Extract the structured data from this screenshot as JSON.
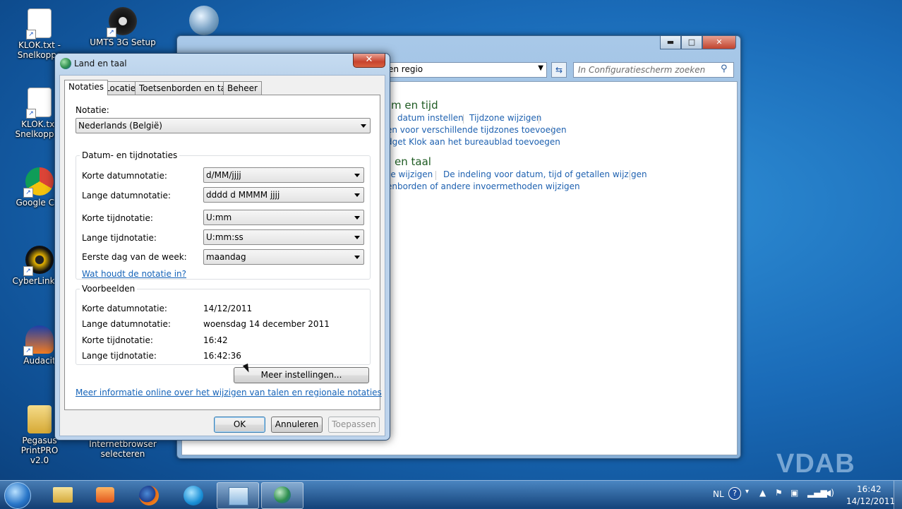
{
  "desktop": {
    "icons": [
      {
        "label": "KLOK.txt - Snelkoppeling",
        "line1": "KLOK.txt -",
        "line2": "Snelkoppe"
      },
      {
        "label": "UMTS 3G Setup",
        "line1": "UMTS 3G Setup",
        "line2": ""
      },
      {
        "label": "KLOK.txt - Snelkoppeling",
        "line1": "KLOK.txt",
        "line2": "Snelkoppeli"
      },
      {
        "label": "Google Chrome",
        "line1": "Google Chr",
        "line2": ""
      },
      {
        "label": "CyberLink",
        "line1": "CyberLink Yo",
        "line2": ""
      },
      {
        "label": "Audacity",
        "line1": "Audacit",
        "line2": ""
      },
      {
        "label": "Pegasus PrintPRO v2.0",
        "line1": "Pegasus PrintPRO",
        "line2": "v2.0"
      },
      {
        "label": "Internetbrowser selecteren",
        "line1": "Internetbrowser",
        "line2": "selecteren"
      }
    ]
  },
  "bg_window": {
    "address_text": "en regio",
    "search_placeholder": "In Configuratiescherm zoeken",
    "section1_title": "m en tijd",
    "section1_links": [
      "datum instellen",
      "Tijdzone wijzigen",
      "en voor verschillende tijdzones toevoegen",
      "dget Klok aan het bureaublad toevoegen"
    ],
    "section2_title": "en taal",
    "section2_links": [
      "le wijzigen",
      "De indeling voor datum, tijd of getallen wijzigen",
      "enborden of andere invoermethoden wijzigen"
    ]
  },
  "dialog": {
    "title": "Land en taal",
    "tabs": [
      "Notaties",
      "Locatie",
      "Toetsenborden en talen",
      "Beheer"
    ],
    "format_label": "Notatie:",
    "format_value": "Nederlands (België)",
    "datetime_group": "Datum- en tijdnotaties",
    "fields": [
      {
        "label": "Korte datumnotatie:",
        "value": "d/MM/jjjj"
      },
      {
        "label": "Lange datumnotatie:",
        "value": "dddd d MMMM jjjj"
      },
      {
        "label": "Korte tijdnotatie:",
        "value": "U:mm"
      },
      {
        "label": "Lange tijdnotatie:",
        "value": "U:mm:ss"
      },
      {
        "label": "Eerste dag van de week:",
        "value": "maandag"
      }
    ],
    "notation_link": "Wat houdt de notatie in?",
    "examples_group": "Voorbeelden",
    "examples": [
      {
        "label": "Korte datumnotatie:",
        "value": "14/12/2011"
      },
      {
        "label": "Lange datumnotatie:",
        "value": "woensdag 14 december 2011"
      },
      {
        "label": "Korte tijdnotatie:",
        "value": "16:42"
      },
      {
        "label": "Lange tijdnotatie:",
        "value": "16:42:36"
      }
    ],
    "more_settings": "Meer instellingen...",
    "info_link": "Meer informatie online over het wijzigen van talen en regionale notaties",
    "ok": "OK",
    "cancel": "Annuleren",
    "apply": "Toepassen"
  },
  "taskbar": {
    "lang": "NL",
    "time": "16:42",
    "date": "14/12/2011"
  },
  "watermark": "VDAB"
}
